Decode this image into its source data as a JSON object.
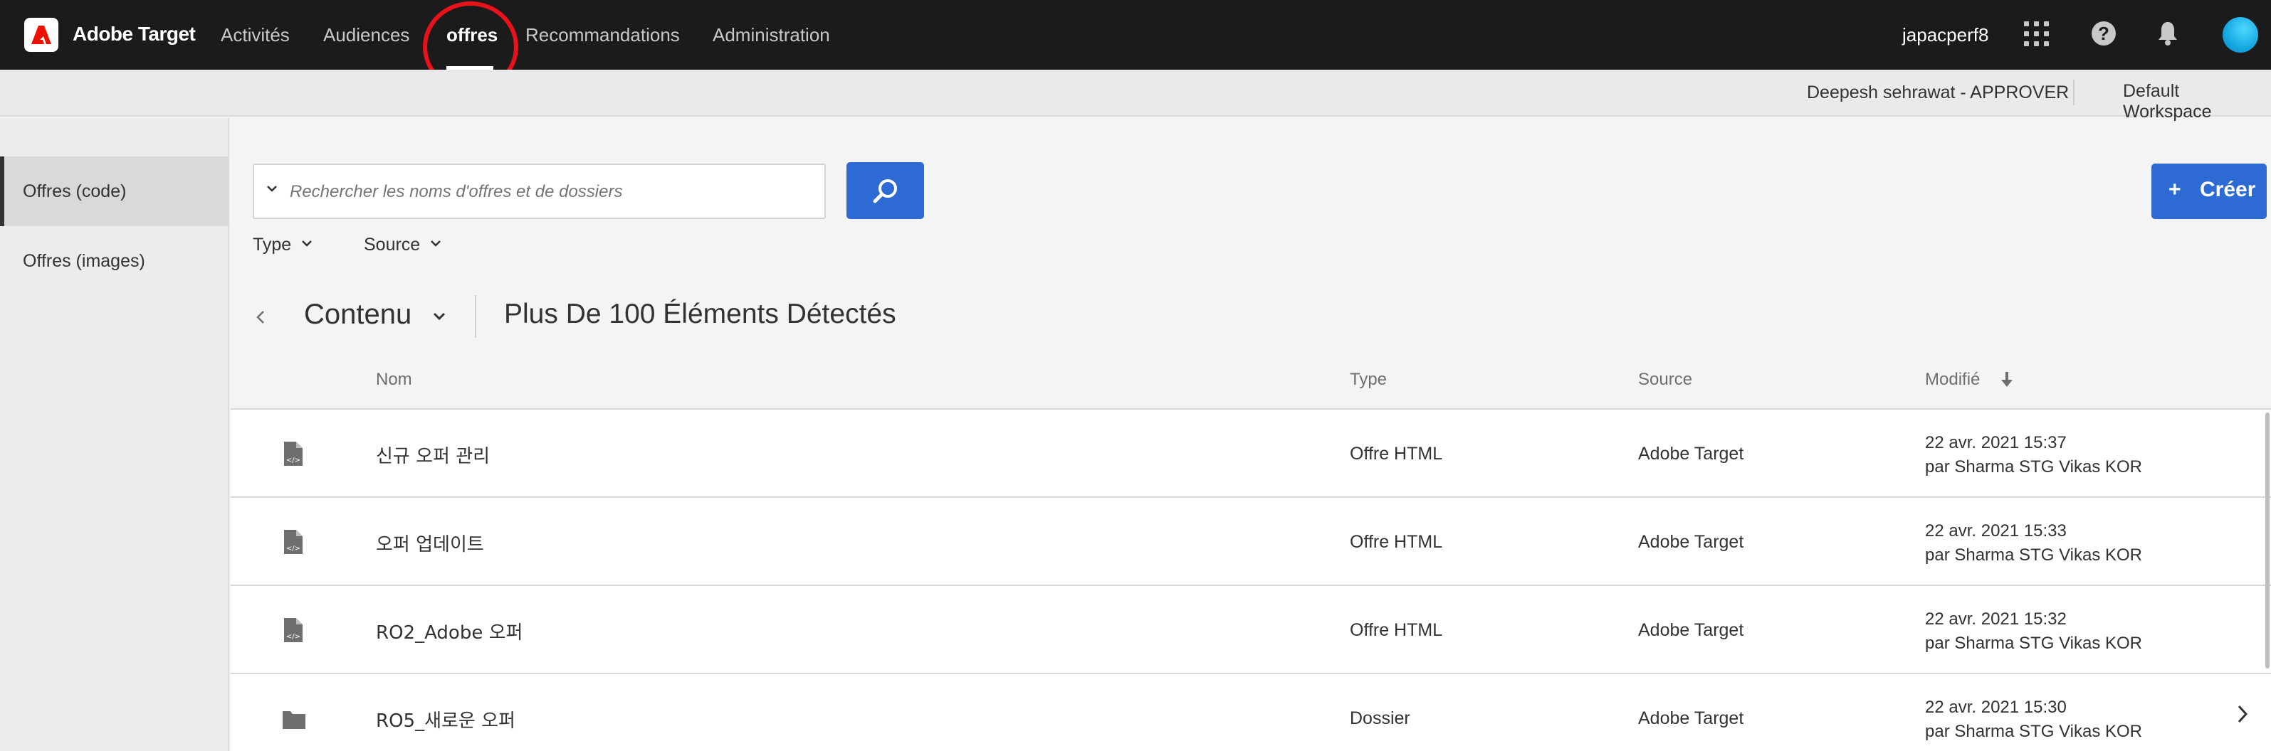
{
  "app": {
    "title": "Adobe Target"
  },
  "nav": {
    "items": [
      {
        "label": "Activités"
      },
      {
        "label": "Audiences"
      },
      {
        "label": "offres"
      },
      {
        "label": "Recommandations"
      },
      {
        "label": "Administration"
      }
    ],
    "active": "offres",
    "user": "japacperf8",
    "icons": [
      "apps-grid-icon",
      "help-icon",
      "bell-icon",
      "avatar"
    ]
  },
  "subbar": {
    "approver": "Deepesh sehrawat - APPROVER",
    "workspace": "Default Workspace"
  },
  "sidebar": {
    "items": [
      {
        "label": "Offres (code)",
        "active": true
      },
      {
        "label": "Offres (images)",
        "active": false
      }
    ]
  },
  "toolbar": {
    "search_placeholder": "Rechercher les noms d'offres et de dossiers",
    "search_value": "",
    "create_label": "Créer",
    "create_icon": "+",
    "filters": [
      {
        "label": "Type"
      },
      {
        "label": "Source"
      }
    ]
  },
  "content": {
    "title": "Contenu",
    "count_text": "Plus De 100 Éléments Détectés"
  },
  "table": {
    "headers": {
      "name": "Nom",
      "type": "Type",
      "source": "Source",
      "modified": "Modifié"
    },
    "rows": [
      {
        "icon": "html-file-icon",
        "name": "신규 오퍼 관리",
        "type": "Offre HTML",
        "source": "Adobe Target",
        "date": "22 avr. 2021  15:37",
        "by": "par Sharma STG Vikas KOR"
      },
      {
        "icon": "html-file-icon",
        "name": "오퍼 업데이트",
        "type": "Offre HTML",
        "source": "Adobe Target",
        "date": "22 avr. 2021  15:33",
        "by": "par Sharma STG Vikas KOR"
      },
      {
        "icon": "html-file-icon",
        "name": "RO2_Adobe 오퍼",
        "type": "Offre HTML",
        "source": "Adobe Target",
        "date": "22 avr. 2021  15:32",
        "by": "par Sharma STG Vikas KOR"
      },
      {
        "icon": "folder-icon",
        "name": "RO5_새로운 오퍼",
        "type": "Dossier",
        "source": "Adobe Target",
        "date": "22 avr. 2021  15:30",
        "by": "par Sharma STG Vikas KOR"
      }
    ]
  },
  "colors": {
    "topnav_bg": "#1b1b1b",
    "accent_blue": "#2d6ad3",
    "highlight_red": "#e8121b",
    "logo_red": "#eb1000"
  }
}
